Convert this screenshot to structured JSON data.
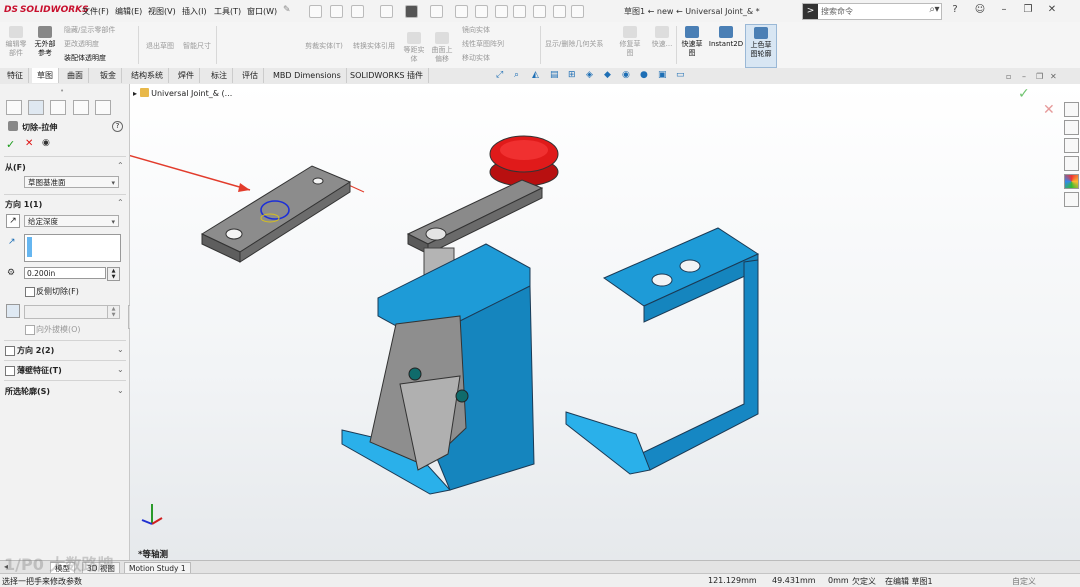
{
  "app": {
    "logo_prefix": "DS",
    "logo": "SOLIDWORKS",
    "doc_title": "草图1 ← new ← Universal Joint_& *"
  },
  "menu": [
    "文件(F)",
    "编辑(E)",
    "视图(V)",
    "插入(I)",
    "工具(T)",
    "窗口(W)"
  ],
  "search": {
    "placeholder": "搜索命令"
  },
  "commands": {
    "edit_component": "编辑零\n部件",
    "no_external_refs": "无外部\n参考",
    "hide_show": "隐藏/显示零部件",
    "change_transparency": "更改透明度",
    "assembly_transparency": "装配体透明度",
    "offset_sketch": "退出草图",
    "smart_dim": "智能尺寸",
    "trim_entities": "剪裁实体(T)",
    "convert_entities": "转换实体引用",
    "offset_entities": "等距实\n体",
    "surface_offset": "曲面上\n偏移",
    "mirror_entities": "镜向实体",
    "linear_pattern": "线性草图阵列",
    "move_entities": "移动实体",
    "display_relations": "显示/删除几何关系",
    "repair_sketch": "修复草\n图",
    "quick_snaps": "快速...",
    "rapid_sketch": "快速草\n图",
    "instant2d": "Instant2D",
    "shaded_sketch": "上色草\n图轮廓"
  },
  "tabs": [
    "特征",
    "草图",
    "曲面",
    "钣金",
    "结构系统",
    "焊件",
    "标注",
    "评估",
    "MBD Dimensions",
    "SOLIDWORKS 插件"
  ],
  "active_tab": "草图",
  "panel": {
    "feature_title": "切除-拉伸",
    "help_icon": "?",
    "from_label": "从(F)",
    "from_value": "草图基准面",
    "dir1_label": "方向 1(1)",
    "end_condition": "给定深度",
    "depth_value": "0.200in",
    "flip_cut": "反侧切除(F)",
    "draft_outward": "向外拔模(O)",
    "dir2_label": "方向 2(2)",
    "thin_feature": "薄壁特征(T)",
    "selected_contours": "所选轮廓(S)"
  },
  "tree": {
    "root": "Universal Joint_& (..."
  },
  "view": {
    "orientation": "*等轴测"
  },
  "bottom_tabs": [
    "模型",
    "3D 视图",
    "Motion Study 1"
  ],
  "status": {
    "hint": "选择一把手来修改参数",
    "x": "121.129mm",
    "y": "49.431mm",
    "z": "0mm",
    "state": "欠定义",
    "editing": "在编辑 草图1",
    "custom": "自定义"
  },
  "colors": {
    "accent": "#1e8fd4",
    "part_blue": "#1e9bd7",
    "part_gray": "#707070",
    "knob_red": "#e01a1a",
    "brand": "#c8102e"
  },
  "watermark": "1/P0 大数路牌"
}
